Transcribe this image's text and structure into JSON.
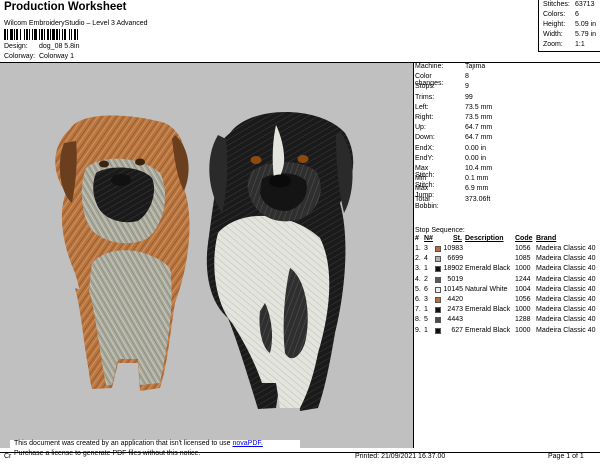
{
  "header": {
    "title": "Production Worksheet",
    "subtitle": "Wilcom EmbroideryStudio – Level 3 Advanced",
    "design_label": "Design:",
    "design_value": "dog_08 5.8in",
    "colorway_label": "Colorway:",
    "colorway_value": "Colorway 1"
  },
  "summary": [
    {
      "label": "Stitches:",
      "value": "63713"
    },
    {
      "label": "Colors:",
      "value": "6"
    },
    {
      "label": "Height:",
      "value": "5.09 in"
    },
    {
      "label": "Width:",
      "value": "5.79 in"
    },
    {
      "label": "Zoom:",
      "value": "1:1"
    }
  ],
  "info": [
    {
      "label": "Machine:",
      "value": "Tajima"
    },
    {
      "label": "Color changes:",
      "value": "8"
    },
    {
      "label": "Stops:",
      "value": "9"
    },
    {
      "label": "Trims:",
      "value": "99"
    },
    {
      "label": "Left:",
      "value": "73.5 mm"
    },
    {
      "label": "Right:",
      "value": "73.5 mm"
    },
    {
      "label": "Up:",
      "value": "64.7 mm"
    },
    {
      "label": "Down:",
      "value": "64.7 mm"
    },
    {
      "label": "EndX:",
      "value": "0.00 in"
    },
    {
      "label": "EndY:",
      "value": "0.00 in"
    },
    {
      "label": "Max Stitch:",
      "value": "10.4 mm"
    },
    {
      "label": "Min Stitch:",
      "value": "0.1 mm"
    },
    {
      "label": "Max Jump:",
      "value": "6.9 mm"
    },
    {
      "label": "Total Bobbin:",
      "value": "373.06ft"
    }
  ],
  "stop_sequence": {
    "title": "Stop Sequence:",
    "headers": {
      "num": "#",
      "n": "N#",
      "st": "St.",
      "desc": "Description",
      "code": "Code",
      "brand": "Brand"
    },
    "rows": [
      {
        "num": "1.",
        "n": "3",
        "color": "#b86e3a",
        "st": "10983",
        "desc": "",
        "code": "1056",
        "brand": "Madeira Classic 40"
      },
      {
        "num": "2.",
        "n": "4",
        "color": "#b3b3ab",
        "st": "6699",
        "desc": "",
        "code": "1085",
        "brand": "Madeira Classic 40"
      },
      {
        "num": "3.",
        "n": "1",
        "color": "#101010",
        "st": "18902",
        "desc": "Emerald Black",
        "code": "1000",
        "brand": "Madeira Classic 40"
      },
      {
        "num": "4.",
        "n": "2",
        "color": "#5a5a5a",
        "st": "5019",
        "desc": "",
        "code": "1244",
        "brand": "Madeira Classic 40"
      },
      {
        "num": "5.",
        "n": "6",
        "color": "#eeeeee",
        "st": "10145",
        "desc": "Natural White",
        "code": "1004",
        "brand": "Madeira Classic 40"
      },
      {
        "num": "6.",
        "n": "3",
        "color": "#b86e3a",
        "st": "4420",
        "desc": "",
        "code": "1056",
        "brand": "Madeira Classic 40"
      },
      {
        "num": "7.",
        "n": "1",
        "color": "#101010",
        "st": "2473",
        "desc": "Emerald Black",
        "code": "1000",
        "brand": "Madeira Classic 40"
      },
      {
        "num": "8.",
        "n": "5",
        "color": "#4b4b4b",
        "st": "4443",
        "desc": "",
        "code": "1288",
        "brand": "Madeira Classic 40"
      },
      {
        "num": "9.",
        "n": "1",
        "color": "#101010",
        "st": "627",
        "desc": "Emerald Black",
        "code": "1000",
        "brand": "Madeira Classic 40"
      }
    ]
  },
  "notice": {
    "line1": "This document was created by an application that isn't licensed to use ",
    "link": "novaPDF.",
    "line2": "Purchase a license to generate PDF files without this notice."
  },
  "footer": {
    "left": "Cr",
    "printed": "Printed: 21/09/2021 16.37.00",
    "page": "Page 1 of 1"
  }
}
